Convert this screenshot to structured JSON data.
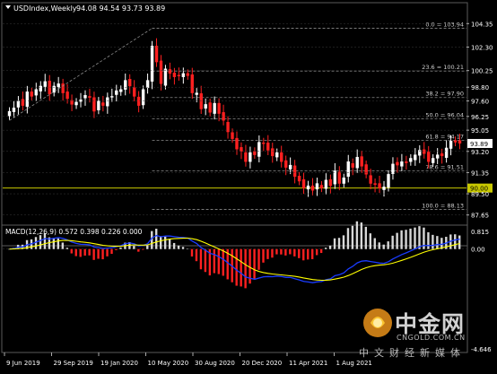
{
  "header": {
    "symbol": "USDIndex,Weekly",
    "ohlc": "94.08 94.54 93.73 93.89"
  },
  "price_axis": {
    "ticks": [
      "104.35",
      "102.30",
      "100.25",
      "98.80",
      "97.60",
      "96.25",
      "95.05",
      "93.20",
      "91.35",
      "89.50",
      "87.65"
    ],
    "current_price": "93.89",
    "current_price_color": "#ffffff",
    "hline_label": "90.00",
    "hline_color": "#c8c800"
  },
  "fibonacci": {
    "color": "#8a8a8a",
    "levels": [
      {
        "label": "0.0 = 103.94",
        "value": 103.94
      },
      {
        "label": "23.6 = 100.21",
        "value": 100.21
      },
      {
        "label": "38.2 = 97.90",
        "value": 97.9
      },
      {
        "label": "50.0 = 96.04",
        "value": 96.04
      },
      {
        "label": "61.8 = 94.17",
        "value": 94.17
      },
      {
        "label": "78.6 = 91.51",
        "value": 91.51
      },
      {
        "label": "100.0 = 88.13",
        "value": 88.13
      }
    ]
  },
  "macd": {
    "label": "MACD(12,26,9) 0.572 0.398 0.226 0.000",
    "axis_ticks": [
      "0.815",
      "0.00",
      "-4.646"
    ]
  },
  "time_axis": {
    "labels": [
      "9 Jun 2019",
      "29 Sep 2019",
      "19 Jan 2020",
      "10 May 2020",
      "30 Aug 2020",
      "20 Dec 2020",
      "11 Apr 2021",
      "1 Aug 2021"
    ]
  },
  "watermark": {
    "brand_cn": "中金网",
    "brand_en": "CNGOLD.COM.CN",
    "tagline": "中文财经新媒体"
  },
  "colors": {
    "background": "#000000",
    "bull": "#ffffff",
    "bear": "#ff2020",
    "grid": "#3a3a3a",
    "macd_signal": "#ffff00",
    "macd_main": "#1a3cff"
  },
  "chart_data": {
    "type": "candlestick",
    "price_range": [
      87.0,
      105.0
    ],
    "series": [
      {
        "name": "USDIndex",
        "close": [
          96.7,
          97.0,
          97.6,
          97.2,
          98.4,
          98.0,
          98.6,
          98.9,
          99.3,
          98.2,
          98.9,
          99.1,
          98.3,
          97.8,
          97.3,
          97.5,
          97.7,
          98.1,
          97.9,
          96.7,
          97.6,
          97.2,
          97.9,
          98.0,
          98.5,
          98.6,
          99.4,
          98.9,
          98.0,
          97.2,
          98.6,
          99.4,
          102.4,
          101.0,
          99.1,
          100.4,
          100.0,
          99.7,
          99.8,
          100.0,
          99.8,
          98.3,
          98.3,
          96.9,
          97.3,
          96.6,
          97.4,
          96.5,
          95.9,
          94.9,
          94.3,
          93.4,
          93.2,
          92.3,
          93.1,
          92.9,
          94.0,
          93.9,
          93.3,
          92.8,
          93.1,
          92.3,
          91.8,
          92.0,
          91.0,
          90.6,
          90.0,
          90.2,
          89.8,
          90.4,
          90.0,
          90.7,
          90.2,
          91.5,
          90.4,
          90.9,
          92.3,
          91.8,
          92.7,
          91.9,
          91.2,
          90.4,
          90.3,
          90.0,
          90.1,
          91.2,
          92.1,
          92.0,
          92.3,
          92.2,
          92.6,
          92.9,
          93.3,
          93.0,
          92.3,
          92.6,
          92.9,
          92.8,
          93.5,
          94.1,
          94.0,
          93.9
        ]
      }
    ],
    "fib_levels": [
      103.94,
      100.21,
      97.9,
      96.04,
      94.17,
      91.51,
      88.13
    ],
    "horizontal_line": 90.0,
    "current_price": 93.89,
    "macd_range": [
      -4.646,
      0.815
    ]
  }
}
